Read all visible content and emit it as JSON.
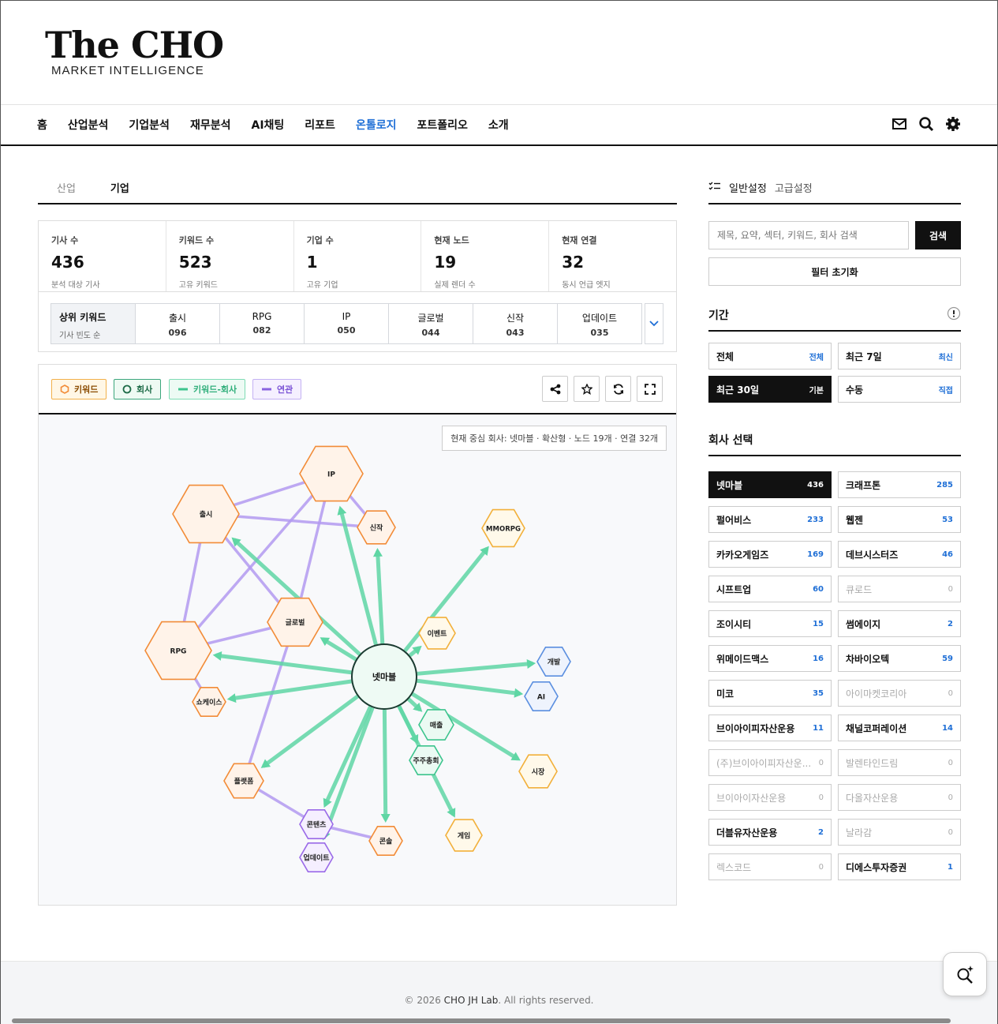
{
  "logo": {
    "title": "The CHO",
    "subtitle": "MARKET INTELLIGENCE"
  },
  "nav": {
    "items": [
      "홈",
      "산업분석",
      "기업분석",
      "재무분석",
      "AI채팅",
      "리포트",
      "온톨로지",
      "포트폴리오",
      "소개"
    ],
    "active": "온톨로지",
    "tools": [
      "mail-icon",
      "search-icon",
      "gear-icon"
    ]
  },
  "subtabs": [
    "산업",
    "기업"
  ],
  "stats": [
    {
      "label": "기사 수",
      "value": "436",
      "sub": "분석 대상 기사"
    },
    {
      "label": "키워드 수",
      "value": "523",
      "sub": "고유 키워드"
    },
    {
      "label": "기업 수",
      "value": "1",
      "sub": "고유 기업"
    },
    {
      "label": "현재 노드",
      "value": "19",
      "sub": "실제 렌더 수"
    },
    {
      "label": "현재 연결",
      "value": "32",
      "sub": "동시 언급 엣지"
    }
  ],
  "top_keywords": {
    "title": "상위 키워드",
    "subtitle": "기사 빈도 순",
    "items": [
      {
        "name": "출시",
        "count": "096"
      },
      {
        "name": "RPG",
        "count": "082"
      },
      {
        "name": "IP",
        "count": "050"
      },
      {
        "name": "글로벌",
        "count": "044"
      },
      {
        "name": "신작",
        "count": "043"
      },
      {
        "name": "업데이트",
        "count": "035"
      }
    ]
  },
  "legend": {
    "keyword": "키워드",
    "company": "회사",
    "kw_company": "키워드-회사",
    "related": "연관"
  },
  "graph": {
    "info": "현재 중심 회사: 넷마블 · 확산형 · 노드 19개 · 연결 32개",
    "center": "넷마블",
    "nodes": [
      "IP",
      "출시",
      "신작",
      "MMORPG",
      "글로벌",
      "이벤트",
      "RPG",
      "개발",
      "AI",
      "쇼케이스",
      "매출",
      "주주총회",
      "시장",
      "플랫폼",
      "콘텐츠",
      "업데이트",
      "콘솔",
      "게임"
    ]
  },
  "side": {
    "tab_general": "일반설정",
    "tab_advanced": "고급설정",
    "search_placeholder": "제목, 요약, 섹터, 키워드, 회사 검색",
    "search_btn": "검색",
    "reset_btn": "필터 초기화",
    "period_title": "기간",
    "periods": [
      {
        "label": "전체",
        "tag": "전체",
        "on": false
      },
      {
        "label": "최근 7일",
        "tag": "최신",
        "on": false
      },
      {
        "label": "최근 30일",
        "tag": "기본",
        "on": true
      },
      {
        "label": "수동",
        "tag": "직접",
        "on": false
      }
    ],
    "company_title": "회사 선택",
    "companies": [
      {
        "name": "넷마블",
        "count": "436",
        "state": "on"
      },
      {
        "name": "크래프톤",
        "count": "285",
        "state": ""
      },
      {
        "name": "펄어비스",
        "count": "233",
        "state": ""
      },
      {
        "name": "웹젠",
        "count": "53",
        "state": ""
      },
      {
        "name": "카카오게임즈",
        "count": "169",
        "state": ""
      },
      {
        "name": "데브시스터즈",
        "count": "46",
        "state": ""
      },
      {
        "name": "시프트업",
        "count": "60",
        "state": ""
      },
      {
        "name": "큐로드",
        "count": "0",
        "state": "dis"
      },
      {
        "name": "조이시티",
        "count": "15",
        "state": ""
      },
      {
        "name": "썸에이지",
        "count": "2",
        "state": ""
      },
      {
        "name": "위메이드맥스",
        "count": "16",
        "state": ""
      },
      {
        "name": "차바이오텍",
        "count": "59",
        "state": ""
      },
      {
        "name": "미코",
        "count": "35",
        "state": ""
      },
      {
        "name": "아이마켓코리아",
        "count": "0",
        "state": "dis"
      },
      {
        "name": "브이아이피자산운용",
        "count": "11",
        "state": ""
      },
      {
        "name": "채널코퍼레이션",
        "count": "14",
        "state": ""
      },
      {
        "name": "(주)브이아이피자산운...",
        "count": "0",
        "state": "dis"
      },
      {
        "name": "발렌타인드림",
        "count": "0",
        "state": "dis"
      },
      {
        "name": "브이아이자산운용",
        "count": "0",
        "state": "dis"
      },
      {
        "name": "다올자산운용",
        "count": "0",
        "state": "dis"
      },
      {
        "name": "더블유자산운용",
        "count": "2",
        "state": ""
      },
      {
        "name": "날라감",
        "count": "0",
        "state": "dis"
      },
      {
        "name": "렉스코드",
        "count": "0",
        "state": "dis"
      },
      {
        "name": "디에스투자증권",
        "count": "1",
        "state": ""
      }
    ]
  },
  "footer": {
    "prefix": "© 2026 ",
    "brand": "CHO JH Lab",
    "suffix": ". All rights reserved."
  },
  "colors": {
    "accent": "#1f6fd6",
    "keyword": "#f28c38",
    "company": "#2e8a5f",
    "kw_company_edge": "#5fd6a4",
    "related_edge": "#a78bf0"
  }
}
